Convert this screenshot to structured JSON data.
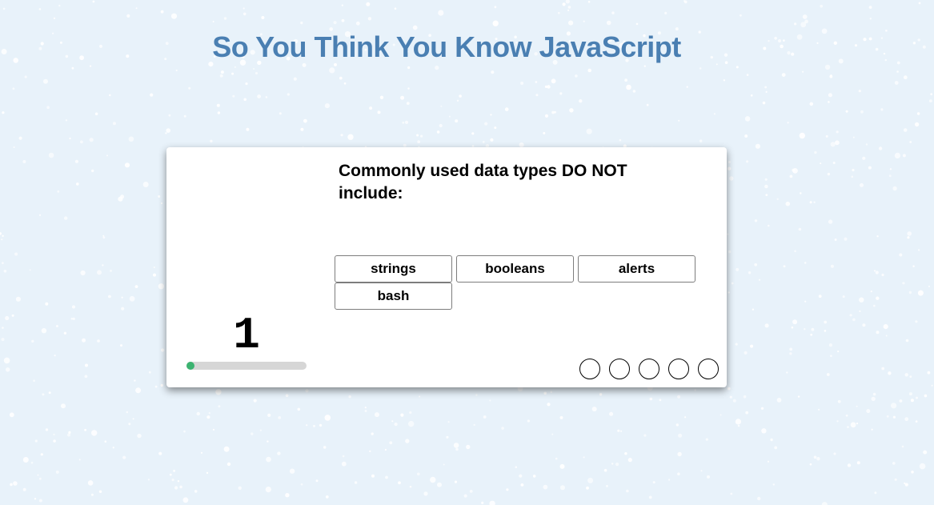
{
  "header": {
    "title": "So You Think You Know JavaScript"
  },
  "quiz": {
    "question": "Commonly used data types DO NOT include:",
    "answers": [
      {
        "label": "strings"
      },
      {
        "label": "booleans"
      },
      {
        "label": "alerts"
      },
      {
        "label": "bash"
      }
    ],
    "timer": {
      "value": "1",
      "progress_fraction": 0.03
    },
    "score_indicators": [
      {
        "state": "empty"
      },
      {
        "state": "empty"
      },
      {
        "state": "empty"
      },
      {
        "state": "empty"
      },
      {
        "state": "empty"
      }
    ]
  },
  "colors": {
    "background": "#e8f2fa",
    "title": "#4a7fb2",
    "progress_fill": "#3cb371",
    "progress_track": "#d6d6d6"
  }
}
